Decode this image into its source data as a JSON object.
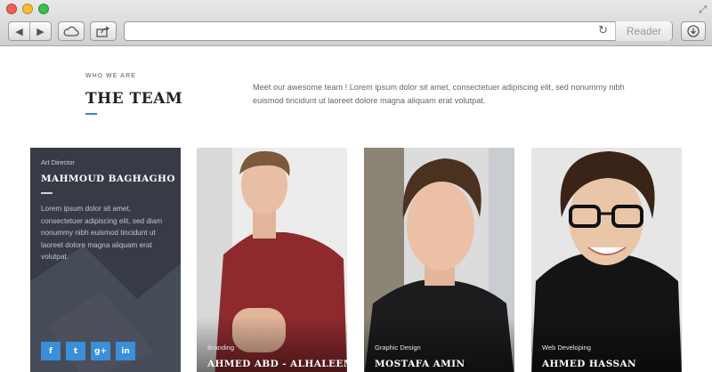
{
  "browser": {
    "nav_back_icon": "◀",
    "nav_forward_icon": "▶",
    "cloud_icon": "icloud-icon",
    "share_icon": "share-icon",
    "url": "",
    "reload_icon": "reload-icon",
    "reader_label": "Reader",
    "download_icon": "download-icon"
  },
  "section": {
    "eyebrow": "WHO WE ARE",
    "title": "THE TEAM",
    "intro": "Meet our awesome team ! Lorem ipsum dolor sit amet, consectetuer adipiscing elit, sed nonummy nibh euismod tincidunt ut laoreet dolore magna aliquam erat volutpat."
  },
  "members": [
    {
      "role": "Art Director",
      "name": "MAHMOUD BAGHAGHO",
      "bio": "Lorem ipsum dolor sit amet, consectetuer adipiscing elit, sed diam nonummy nibh euismod tincidunt ut laoreet dolore magna aliquam erat volutpat.",
      "socials": [
        "f",
        "t",
        "g+",
        "in"
      ]
    },
    {
      "role": "Branding",
      "name": "AHMED ABD - ALHALEEM"
    },
    {
      "role": "Graphic Design",
      "name": "MOSTAFA AMIN"
    },
    {
      "role": "Web Developing",
      "name": "AHMED HASSAN"
    }
  ],
  "colors": {
    "accent": "#3b82d6",
    "featured_card": "#363b46",
    "social_button": "#3b8ed8"
  }
}
